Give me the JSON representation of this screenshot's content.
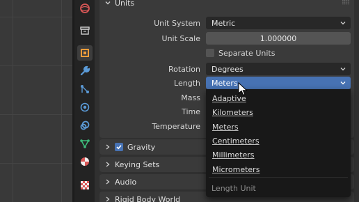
{
  "properties": {
    "units_section": {
      "title": "Units",
      "unit_system": {
        "label": "Unit System",
        "value": "Metric"
      },
      "unit_scale": {
        "label": "Unit Scale",
        "value": "1.000000"
      },
      "separate_units": {
        "label": "Separate Units",
        "checked": false
      },
      "rotation": {
        "label": "Rotation",
        "value": "Degrees"
      },
      "length": {
        "label": "Length",
        "value": "Meters"
      },
      "mass": {
        "label": "Mass"
      },
      "time": {
        "label": "Time"
      },
      "temperature": {
        "label": "Temperature"
      }
    },
    "subpanels": [
      {
        "label": "Gravity",
        "has_checkbox": true,
        "checked": true
      },
      {
        "label": "Keying Sets"
      },
      {
        "label": "Audio"
      },
      {
        "label": "Rigid Body World"
      }
    ]
  },
  "length_dropdown": {
    "items": [
      "Adaptive",
      "Kilometers",
      "Meters",
      "Centimeters",
      "Millimeters",
      "Micrometers"
    ],
    "footer": "Length Unit"
  },
  "colors": {
    "accent": "#4772b3",
    "panel": "#3a3a3a",
    "field": "#282828",
    "dropdown_bg": "#181818"
  },
  "sidebar_tabs": [
    "scene-tab-icon",
    "output-tab-icon",
    "object-tab-icon",
    "modifier-tab-icon",
    "particles-tab-icon",
    "physics-tab-icon",
    "constraints-tab-icon",
    "data-tab-icon",
    "material-tab-icon",
    "texture-tab-icon"
  ]
}
